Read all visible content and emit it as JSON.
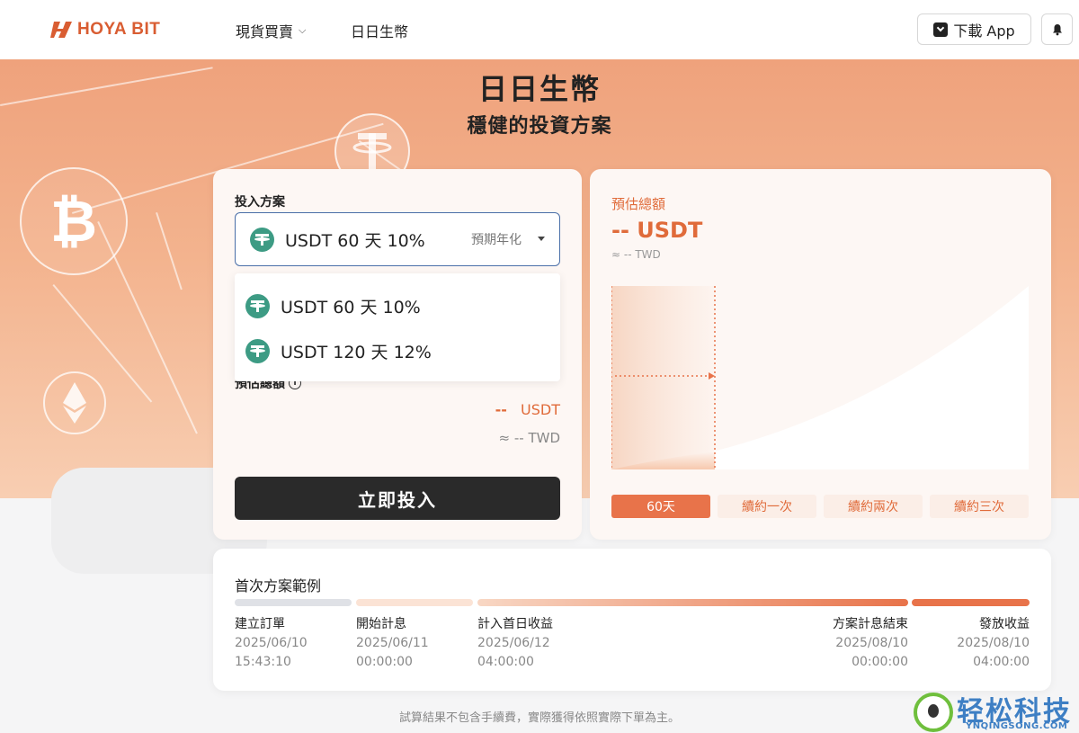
{
  "header": {
    "logo_text": "HOYA BIT",
    "nav": [
      {
        "label": "現貨買賣",
        "has_dropdown": true
      },
      {
        "label": "日日生幣",
        "has_dropdown": false
      }
    ],
    "download_label": "下載 App",
    "icons": {
      "download": "download-icon",
      "bell": "bell-icon"
    }
  },
  "hero": {
    "title": "日日生幣",
    "subtitle": "穩健的投資方案"
  },
  "plan_card": {
    "plan_label": "投入方案",
    "selected_plan": "USDT 60 天 10%",
    "selected_hint": "預期年化",
    "options": [
      {
        "label": "USDT 60 天 10%"
      },
      {
        "label": "USDT 120 天 12%"
      }
    ],
    "estimate_label": "預估總額",
    "estimate_usdt_value": "--",
    "estimate_usdt_unit": "USDT",
    "estimate_twd": "≈ -- TWD",
    "invest_button": "立即投入"
  },
  "estimate_card": {
    "label": "預估總額",
    "value": "-- USDT",
    "twd": "≈ -- TWD",
    "tabs": [
      {
        "label": "60天",
        "active": true
      },
      {
        "label": "續約一次",
        "active": false
      },
      {
        "label": "續約兩次",
        "active": false
      },
      {
        "label": "續約三次",
        "active": false
      }
    ]
  },
  "example": {
    "title": "首次方案範例",
    "steps": [
      {
        "label": "建立訂單",
        "date": "2025/06/10",
        "time": "15:43:10"
      },
      {
        "label": "開始計息",
        "date": "2025/06/11",
        "time": "00:00:00"
      },
      {
        "label": "計入首日收益",
        "date": "2025/06/12",
        "time": "04:00:00"
      },
      {
        "label": "方案計息結束",
        "date": "2025/08/10",
        "time": "00:00:00"
      },
      {
        "label": "發放收益",
        "date": "2025/08/10",
        "time": "04:00:00"
      }
    ]
  },
  "disclaimer": "試算結果不包含手續費，實際獲得依照實際下單為主。",
  "watermark": {
    "text": "轻松科技",
    "url": "YNQINGSONG.COM"
  },
  "colors": {
    "accent": "#e8734a",
    "dark_button": "#2a2a2a",
    "usdt_green": "#3d9b84"
  }
}
